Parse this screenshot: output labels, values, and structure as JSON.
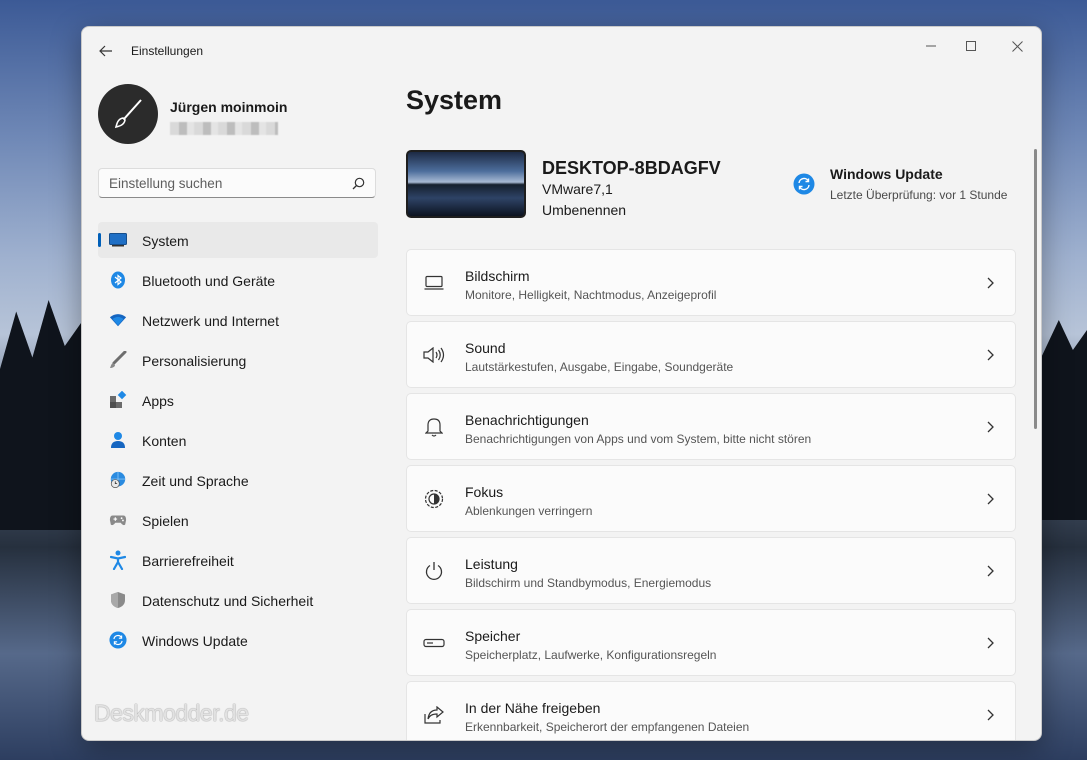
{
  "window": {
    "title": "Einstellungen"
  },
  "user": {
    "name": "Jürgen moinmoin"
  },
  "search": {
    "placeholder": "Einstellung suchen"
  },
  "sidebar": {
    "items": [
      {
        "label": "System",
        "icon": "monitor-icon",
        "active": true
      },
      {
        "label": "Bluetooth und Geräte",
        "icon": "bluetooth-icon"
      },
      {
        "label": "Netzwerk und Internet",
        "icon": "wifi-icon"
      },
      {
        "label": "Personalisierung",
        "icon": "brush-icon"
      },
      {
        "label": "Apps",
        "icon": "apps-icon"
      },
      {
        "label": "Konten",
        "icon": "person-icon"
      },
      {
        "label": "Zeit und Sprache",
        "icon": "globe-clock-icon"
      },
      {
        "label": "Spielen",
        "icon": "gamepad-icon"
      },
      {
        "label": "Barrierefreiheit",
        "icon": "accessibility-icon"
      },
      {
        "label": "Datenschutz und Sicherheit",
        "icon": "shield-icon"
      },
      {
        "label": "Windows Update",
        "icon": "sync-icon"
      }
    ]
  },
  "main": {
    "page_title": "System",
    "device": {
      "name": "DESKTOP-8BDAGFV",
      "model": "VMware7,1",
      "rename_label": "Umbenennen"
    },
    "windows_update": {
      "title": "Windows Update",
      "status": "Letzte Überprüfung: vor 1 Stunde"
    },
    "cards": [
      {
        "title": "Bildschirm",
        "desc": "Monitore, Helligkeit, Nachtmodus, Anzeigeprofil",
        "icon": "display-icon"
      },
      {
        "title": "Sound",
        "desc": "Lautstärkestufen, Ausgabe, Eingabe, Soundgeräte",
        "icon": "speaker-icon"
      },
      {
        "title": "Benachrichtigungen",
        "desc": "Benachrichtigungen von Apps und vom System, bitte nicht stören",
        "icon": "bell-icon"
      },
      {
        "title": "Fokus",
        "desc": "Ablenkungen verringern",
        "icon": "focus-icon"
      },
      {
        "title": "Leistung",
        "desc": "Bildschirm und Standbymodus, Energiemodus",
        "icon": "power-icon"
      },
      {
        "title": "Speicher",
        "desc": "Speicherplatz, Laufwerke, Konfigurationsregeln",
        "icon": "storage-icon"
      },
      {
        "title": "In der Nähe freigeben",
        "desc": "Erkennbarkeit, Speicherort der empfangenen Dateien",
        "icon": "share-icon"
      }
    ]
  },
  "watermark": "Deskmodder.de",
  "colors": {
    "accent": "#005fb8",
    "window_bg": "#f3f3f3",
    "card_bg": "#fbfbfb"
  }
}
